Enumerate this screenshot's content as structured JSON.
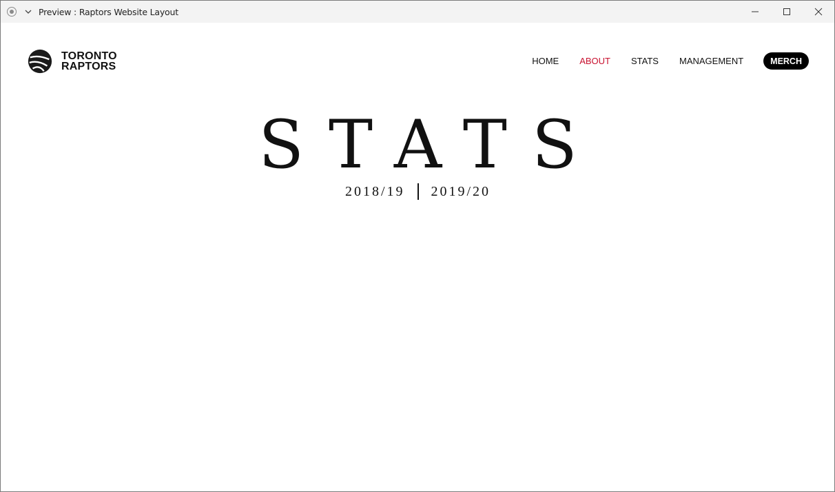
{
  "window": {
    "title": "Preview : Raptors Website Layout",
    "controls": [
      "minimize-icon",
      "maximize-icon",
      "close-icon"
    ]
  },
  "logo": {
    "line1": "TORONTO",
    "line2": "RAPTORS",
    "icon": "basketball-claw-icon"
  },
  "nav": {
    "items": [
      {
        "label": "HOME",
        "active": false
      },
      {
        "label": "ABOUT",
        "active": true
      },
      {
        "label": "STATS",
        "active": false
      },
      {
        "label": "MANAGEMENT",
        "active": false
      }
    ],
    "merch_label": "MERCH",
    "active_color": "#c8102e"
  },
  "hero": {
    "title": "STATS",
    "seasons": [
      "2018/19",
      "2019/20"
    ]
  }
}
